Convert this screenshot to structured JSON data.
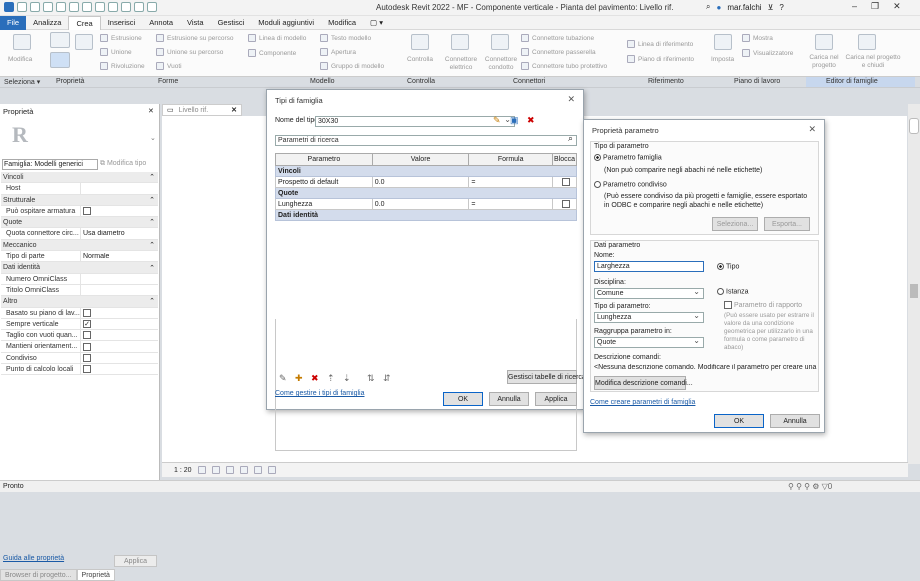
{
  "window": {
    "title": "Autodesk Revit 2022 - MF - Componente verticale - Pianta del pavimento: Livello rif.",
    "user": "mar.falchi"
  },
  "menu": {
    "tabs": [
      "File",
      "Analizza",
      "Crea",
      "Inserisci",
      "Annota",
      "Vista",
      "Gestisci",
      "Moduli aggiuntivi",
      "Modifica",
      "▢ ▾"
    ],
    "active": "Crea"
  },
  "ribbon": {
    "buttons": {
      "modifica": "Modifica",
      "estrusione": "Estrusione",
      "unione": "Unione",
      "rivoluzione": "Rivoluzione",
      "estrusione_percorso": "Estrusione su percorso",
      "unione_percorso": "Unione su percorso",
      "vuoti": "Vuoti",
      "linea_modello": "Linea di modello",
      "testo_modello": "Testo modello",
      "componente": "Componente",
      "apertura": "Apertura",
      "gruppo_modello": "Gruppo di modello",
      "controlla": "Controlla",
      "connettore_elettrico": "Connettore elettrico",
      "connettore_condotto": "Connettore condotto",
      "connettore_tubazione": "Connettore tubazione",
      "connettore_passerella": "Connettore passerella",
      "connettore_tubo_protettivo": "Connettore tubo protettivo",
      "linea_riferimento": "Linea di riferimento",
      "piano_riferimento": "Piano di riferimento",
      "imposta": "Imposta",
      "mostra": "Mostra",
      "visualizzatore": "Visualizzatore",
      "carica_progetto": "Carica nel progetto",
      "carica_chiudi": "Carica nel progetto e chiudi"
    },
    "groups": {
      "seleziona": "Seleziona ▾",
      "proprieta": "Proprietà",
      "forme": "Forme",
      "modello": "Modello",
      "controlla": "Controlla",
      "connettori": "Connettori",
      "riferimento": "Riferimento",
      "piano_lavoro": "Piano di lavoro",
      "editor_famiglie": "Editor di famiglie"
    }
  },
  "properties_panel": {
    "title": "Proprietà",
    "type_selector": "Famiglia: Modelli generici",
    "modifica_tipo": "Modifica tipo",
    "rows": [
      {
        "section": true,
        "name": "Vincoli"
      },
      {
        "name": "Host",
        "value": "",
        "disabled": true
      },
      {
        "section": true,
        "name": "Strutturale"
      },
      {
        "name": "Può ospitare armatura",
        "check": false
      },
      {
        "section": true,
        "name": "Quote"
      },
      {
        "name": "Quota connettore circ...",
        "value": "Usa diametro"
      },
      {
        "section": true,
        "name": "Meccanico"
      },
      {
        "name": "Tipo di parte",
        "value": "Normale"
      },
      {
        "section": true,
        "name": "Dati identità"
      },
      {
        "name": "Numero OmniClass",
        "value": "",
        "disabled": true
      },
      {
        "name": "Titolo OmniClass",
        "value": "",
        "disabled": true
      },
      {
        "section": true,
        "name": "Altro"
      },
      {
        "name": "Basato su piano di lav...",
        "check": false
      },
      {
        "name": "Sempre verticale",
        "check": true
      },
      {
        "name": "Taglio con vuoti quan...",
        "check": false
      },
      {
        "name": "Mantieni orientament...",
        "check": false
      },
      {
        "name": "Condiviso",
        "check": false
      },
      {
        "name": "Punto di calcolo locali",
        "check": false
      }
    ],
    "guide_link": "Guida alle proprietà",
    "apply": "Applica",
    "tabs": [
      "Browser di progetto...",
      "Proprietà"
    ]
  },
  "view": {
    "tab": "Livello rif.",
    "scale": "1 : 20"
  },
  "status": {
    "text": "Pronto"
  },
  "family_types_dialog": {
    "title": "Tipi di famiglia",
    "type_name_label": "Nome del tipo:",
    "type_name": "30X30",
    "search_placeholder": "Parametri di ricerca",
    "columns": [
      "Parametro",
      "Valore",
      "Formula",
      "Blocca"
    ],
    "rows": [
      {
        "section": true,
        "name": "Vincoli"
      },
      {
        "name": "Prospetto di default",
        "value": "0.0",
        "formula": "="
      },
      {
        "section": true,
        "name": "Quote"
      },
      {
        "name": "Lunghezza",
        "value": "0.0",
        "formula": "="
      },
      {
        "section": true,
        "name": "Dati identità"
      }
    ],
    "manage_tables": "Gestisci tabelle di ricerca",
    "link": "Come gestire i tipi di famiglia",
    "ok": "OK",
    "cancel": "Annulla",
    "apply": "Applica"
  },
  "param_dialog": {
    "title": "Proprietà parametro",
    "tipo_label": "Tipo di parametro",
    "famiglia": "Parametro famiglia",
    "famiglia_note": "(Non può comparire negli abachi né nelle etichette)",
    "condiviso": "Parametro condiviso",
    "condiviso_note": "(Può essere condiviso da più progetti e famiglie, essere esportato in ODBC e comparire negli abachi e nelle etichette)",
    "seleziona": "Seleziona...",
    "esporta": "Esporta...",
    "dati_label": "Dati parametro",
    "nome_label": "Nome:",
    "nome_value": "Larghezza",
    "tipo_radio": "Tipo",
    "istanza_radio": "Istanza",
    "disciplina_label": "Disciplina:",
    "disciplina_value": "Comune",
    "tipo_param_label": "Tipo di parametro:",
    "tipo_param_value": "Lunghezza",
    "rapporto": "Parametro di rapporto",
    "rapporto_note": "(Può essere usato per estrarre il valore da una condizione geometrica per utilizzarlo in una formula o come parametro di abaco)",
    "raggruppa_label": "Raggruppa parametro in:",
    "raggruppa_value": "Quote",
    "descr_label": "Descrizione comandi:",
    "descr_value": "<Nessuna descrizione comando. Modificare il parametro per creare una",
    "modifica_descr": "Modifica descrizione comandi...",
    "link": "Come creare parametri di famiglia",
    "ok": "OK",
    "cancel": "Annulla"
  }
}
